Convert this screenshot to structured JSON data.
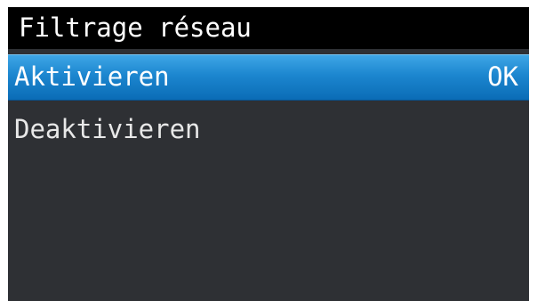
{
  "screen": {
    "title": "Filtrage réseau",
    "items": [
      {
        "label": "Aktivieren",
        "status": "OK",
        "selected": true
      },
      {
        "label": "Deaktivieren",
        "status": "",
        "selected": false
      }
    ]
  },
  "colors": {
    "title_bar": "#000000",
    "background": "#2e3034",
    "selection": "#1c86cf",
    "text": "#ffffff"
  }
}
